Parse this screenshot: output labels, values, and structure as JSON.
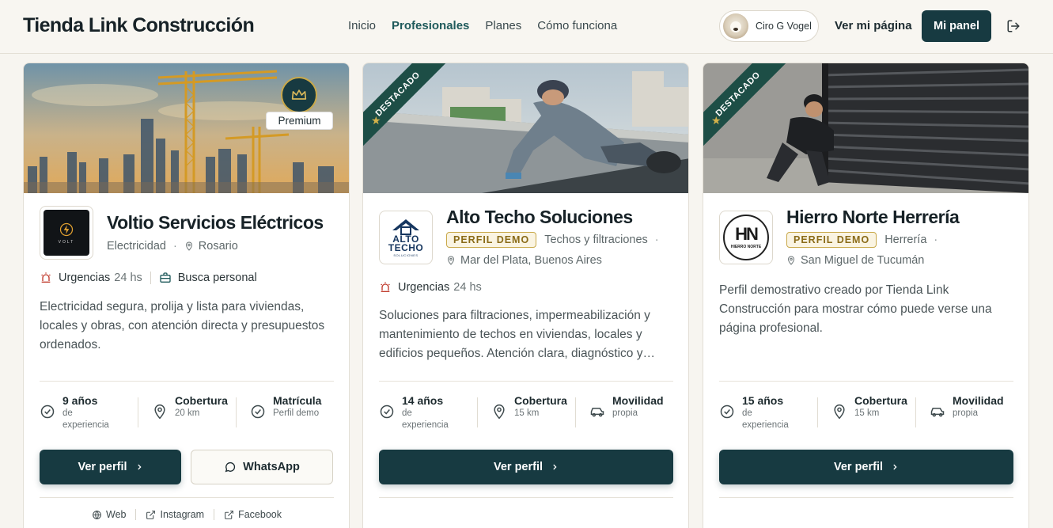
{
  "header": {
    "brand": "Tienda Link Construcción",
    "nav": [
      "Inicio",
      "Profesionales",
      "Planes",
      "Cómo funciona"
    ],
    "active_nav": "Profesionales",
    "user_name": "Ciro G Vogel",
    "view_page": "Ver mi página",
    "panel_button": "Mi panel"
  },
  "cards": [
    {
      "name": "Voltio Servicios Eléctricos",
      "category": "Electricidad",
      "location": "Rosario",
      "badge": "Premium",
      "urgencias": "Urgencias",
      "hours": "24 hs",
      "busca": "Busca personal",
      "description": "Electricidad segura, prolija y lista para viviendas, locales y obras, con atención directa y presupuestos ordenados.",
      "stat1_title": "9 años",
      "stat1_sub": "de experiencia",
      "stat2_title": "Cobertura",
      "stat2_sub": "20 km",
      "stat3_title": "Matrícula",
      "stat3_sub": "Perfil demo",
      "primary_btn": "Ver perfil",
      "whatsapp_btn": "WhatsApp",
      "links": [
        "Web",
        "Instagram",
        "Facebook"
      ],
      "logo_text": "VOLT"
    },
    {
      "name": "Alto Techo Soluciones",
      "ribbon": "DESTACADO",
      "demo_badge": "PERFIL DEMO",
      "category": "Techos y filtraciones",
      "location": "Mar del Plata, Buenos Aires",
      "urgencias": "Urgencias",
      "hours": "24 hs",
      "description": "Soluciones para filtraciones, impermeabilización y mantenimiento de techos en viviendas, locales y edificios pequeños. Atención clara, diagnóstico y presupuestos ordenados.",
      "stat1_title": "14 años",
      "stat1_sub": "de experiencia",
      "stat2_title": "Cobertura",
      "stat2_sub": "15 km",
      "stat3_title": "Movilidad",
      "stat3_sub": "propia",
      "primary_btn": "Ver perfil",
      "logo_line1": "ALTO",
      "logo_line2": "TECHO",
      "logo_line3": "SOLUCIONES"
    },
    {
      "name": "Hierro Norte Herrería",
      "ribbon": "DESTACADO",
      "demo_badge": "PERFIL DEMO",
      "category": "Herrería",
      "location": "San Miguel de Tucumán",
      "description": "Perfil demostrativo creado por Tienda Link Construcción para mostrar cómo puede verse una página profesional.",
      "stat1_title": "15 años",
      "stat1_sub": "de experiencia",
      "stat2_title": "Cobertura",
      "stat2_sub": "15 km",
      "stat3_title": "Movilidad",
      "stat3_sub": "propia",
      "primary_btn": "Ver perfil",
      "logo_text": "HIERRO NORTE"
    }
  ],
  "colors": {
    "primary": "#173a41",
    "gold": "#c9a94a",
    "urgent": "#c0392b",
    "ribbon": "#1d4e46"
  }
}
